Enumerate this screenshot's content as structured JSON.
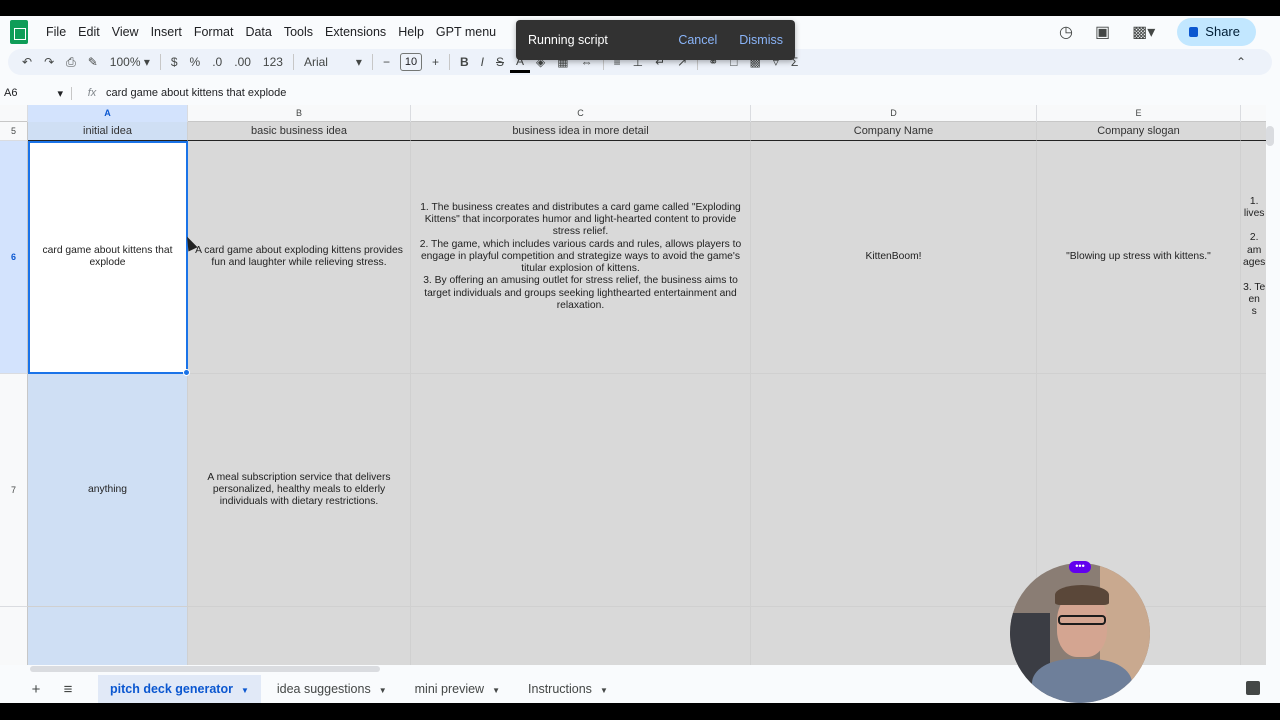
{
  "menu": [
    "File",
    "Edit",
    "View",
    "Insert",
    "Format",
    "Data",
    "Tools",
    "Extensions",
    "Help",
    "GPT menu"
  ],
  "share_label": "Share",
  "toast": {
    "message": "Running script",
    "cancel": "Cancel",
    "dismiss": "Dismiss"
  },
  "toolbar": {
    "zoom": "100%",
    "currency": "$",
    "percent": "%",
    "dec_decrease": ".0",
    "dec_increase": ".00",
    "format_123": "123",
    "font": "Arial",
    "font_size": "10",
    "bold": "B",
    "italic": "I",
    "text_color": "A"
  },
  "formula_bar": {
    "cell_ref": "A6",
    "fx": "fx",
    "content": "card game about kittens that explode"
  },
  "columns": [
    "A",
    "B",
    "C",
    "D",
    "E"
  ],
  "rows": [
    {
      "num": "5",
      "cells": [
        "initial idea",
        "basic business idea",
        "business idea in more detail",
        "Company Name",
        "Company slogan"
      ]
    },
    {
      "num": "6",
      "cells": [
        "card game about kittens that explode",
        "A card game about exploding kittens provides fun and laughter while relieving stress.",
        "1. The business creates and distributes a card game called \"Exploding Kittens\" that incorporates humor and light-hearted content to provide stress relief.\n2. The game, which includes various cards and rules, allows players to engage in playful competition and strategize ways to avoid the game's titular explosion of kittens.\n3. By offering an amusing outlet for stress relief, the business aims to target individuals and groups seeking lighthearted entertainment and relaxation.",
        "KittenBoom!",
        "\"Blowing up stress with kittens.\"",
        "1.\nlives\n\n2.\nam\nages\n\n3. Te\nen\ns"
      ]
    },
    {
      "num": "7",
      "cells": [
        "anything",
        "A meal subscription service that delivers personalized, healthy meals to elderly individuals with dietary restrictions.",
        "",
        "",
        ""
      ]
    }
  ],
  "sheet_tabs": [
    "pitch deck generator",
    "idea suggestions",
    "mini preview",
    "Instructions"
  ],
  "colors": {
    "accent": "#1a73e8",
    "toast_bg": "#323232",
    "toast_btn": "#8ab4f8",
    "cell_gray": "#d9d9d9"
  }
}
